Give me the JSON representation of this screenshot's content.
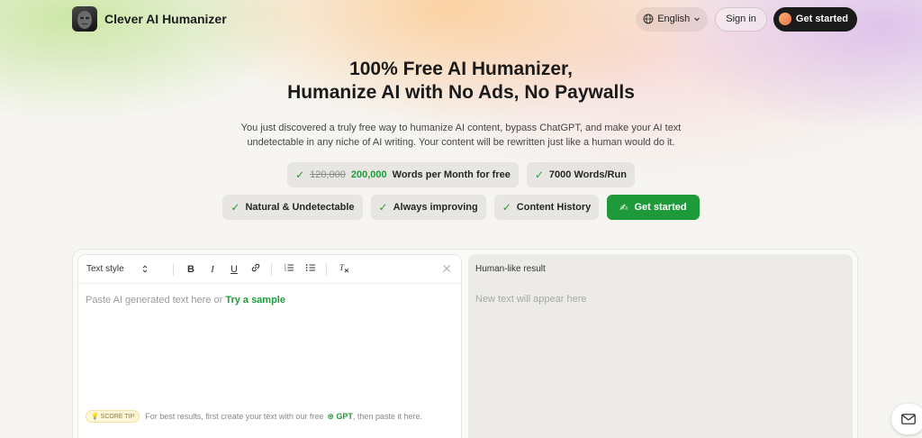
{
  "header": {
    "brand": "Clever AI Humanizer",
    "language": "English",
    "sign_in": "Sign in",
    "get_started": "Get started"
  },
  "hero": {
    "title_line1": "100% Free AI Humanizer,",
    "title_line2": "Humanize AI with No Ads, No Paywalls",
    "subtitle_line1": "You just discovered a truly free way to humanize AI content, bypass ChatGPT, and make your AI text",
    "subtitle_line2": "undetectable in any niche of AI writing. Your content will be rewritten just like a human would do it."
  },
  "features": {
    "words_old": "120,000",
    "words_new": "200,000",
    "words_suffix": "Words per Month for free",
    "per_run": "7000 Words/Run",
    "natural": "Natural & Undetectable",
    "improving": "Always improving",
    "history": "Content History",
    "cta": "Get started",
    "cta_icon": "✍"
  },
  "editor": {
    "text_style": "Text style",
    "placeholder_prefix": "Paste AI generated text here or",
    "try_sample": "Try a sample",
    "score_tip_badge": "SCORE TIP",
    "score_tip_pre": "For best results, first create your text with our free",
    "score_tip_gpt": "GPT",
    "score_tip_post": ", then paste it here."
  },
  "result": {
    "title": "Human-like result",
    "placeholder": "New text will appear here"
  },
  "colors": {
    "accent_green": "#1f9a3a",
    "dark_button": "#1b1b1b"
  },
  "icons": [
    "globe-icon",
    "chevron-down-icon",
    "check-icon",
    "bold-icon",
    "italic-icon",
    "underline-icon",
    "link-icon",
    "ordered-list-icon",
    "bullet-list-icon",
    "clear-format-icon",
    "close-icon",
    "mail-icon"
  ]
}
